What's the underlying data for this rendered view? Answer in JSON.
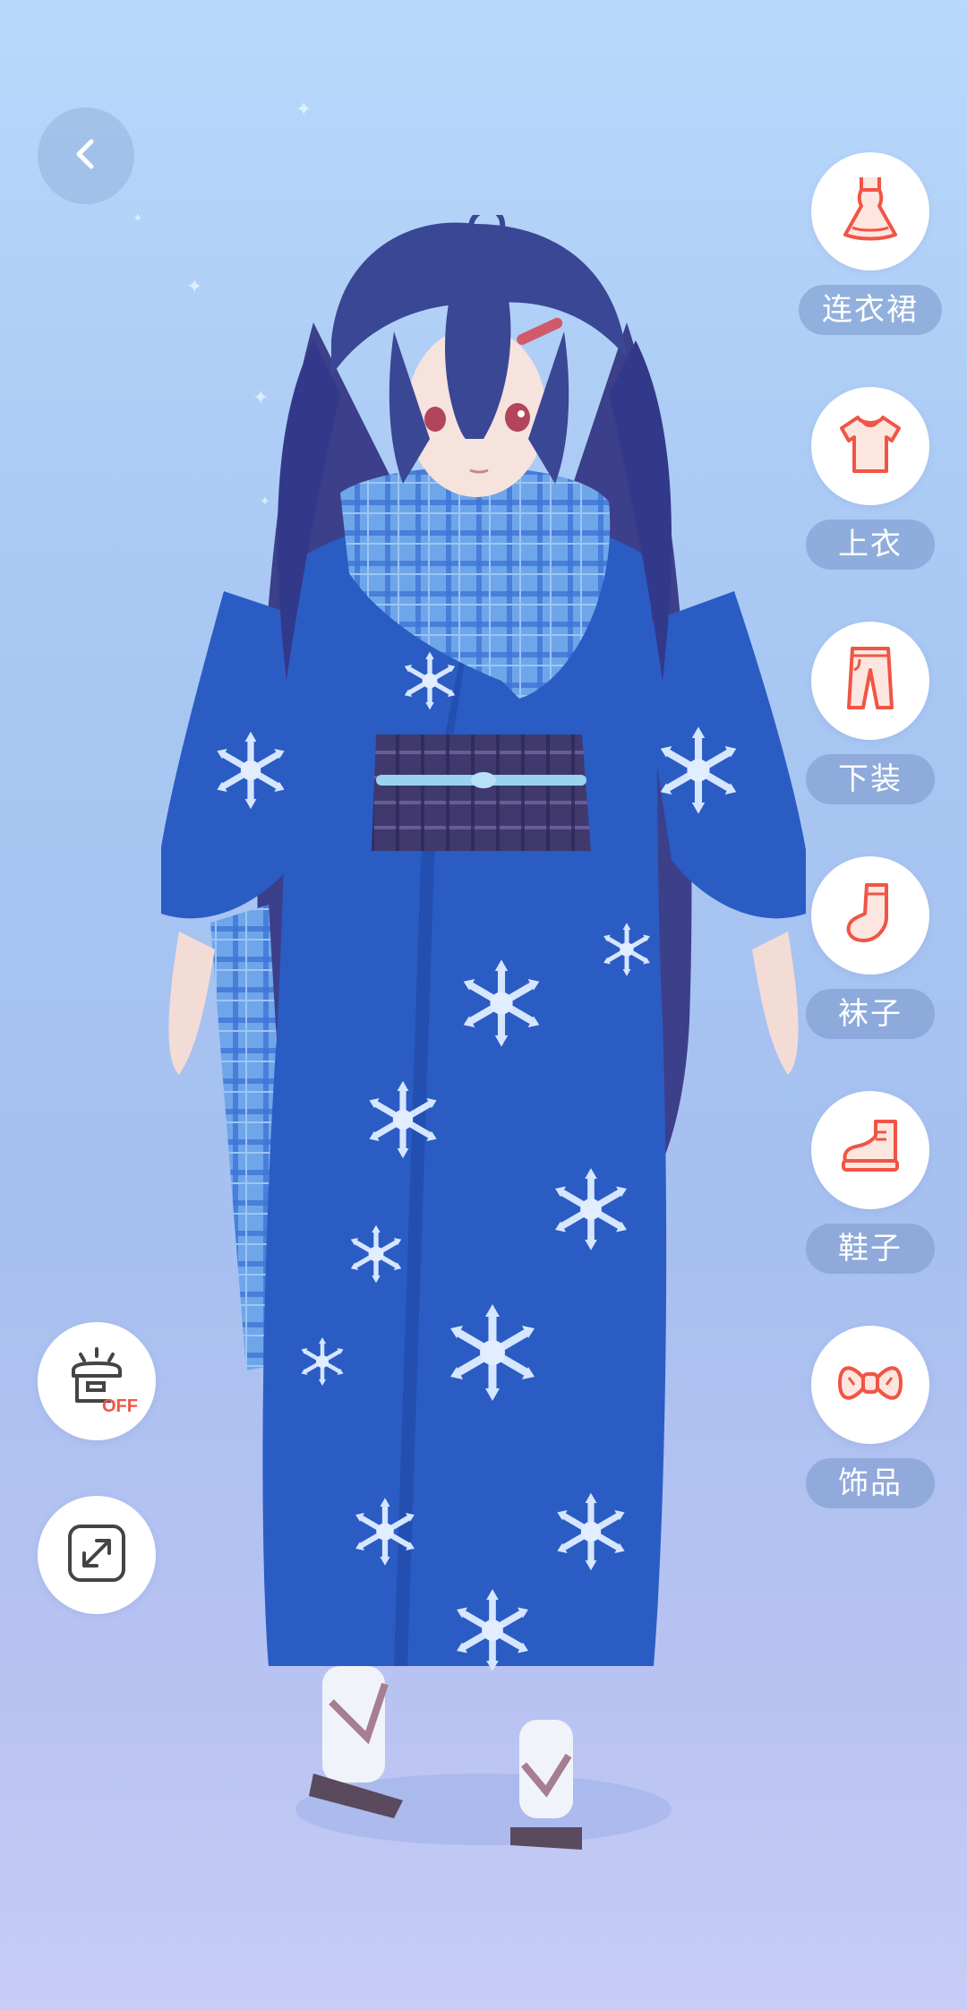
{
  "nav": {
    "back_icon": "chevron-left-icon"
  },
  "categories": [
    {
      "label": "连衣裙",
      "icon": "dress-icon"
    },
    {
      "label": "上衣",
      "icon": "shirt-icon"
    },
    {
      "label": "下装",
      "icon": "pants-icon"
    },
    {
      "label": "袜子",
      "icon": "sock-icon"
    },
    {
      "label": "鞋子",
      "icon": "shoe-icon"
    },
    {
      "label": "饰品",
      "icon": "bow-icon"
    }
  ],
  "tools": {
    "light_toggle_badge": "OFF",
    "light_toggle_icon": "lamp-off-icon",
    "fullscreen_icon": "expand-icon"
  },
  "colors": {
    "accent": "#f05545",
    "background_top": "#b9d8fb",
    "background_bottom": "#c7cdf5",
    "kimono": "#2a5cc4"
  }
}
